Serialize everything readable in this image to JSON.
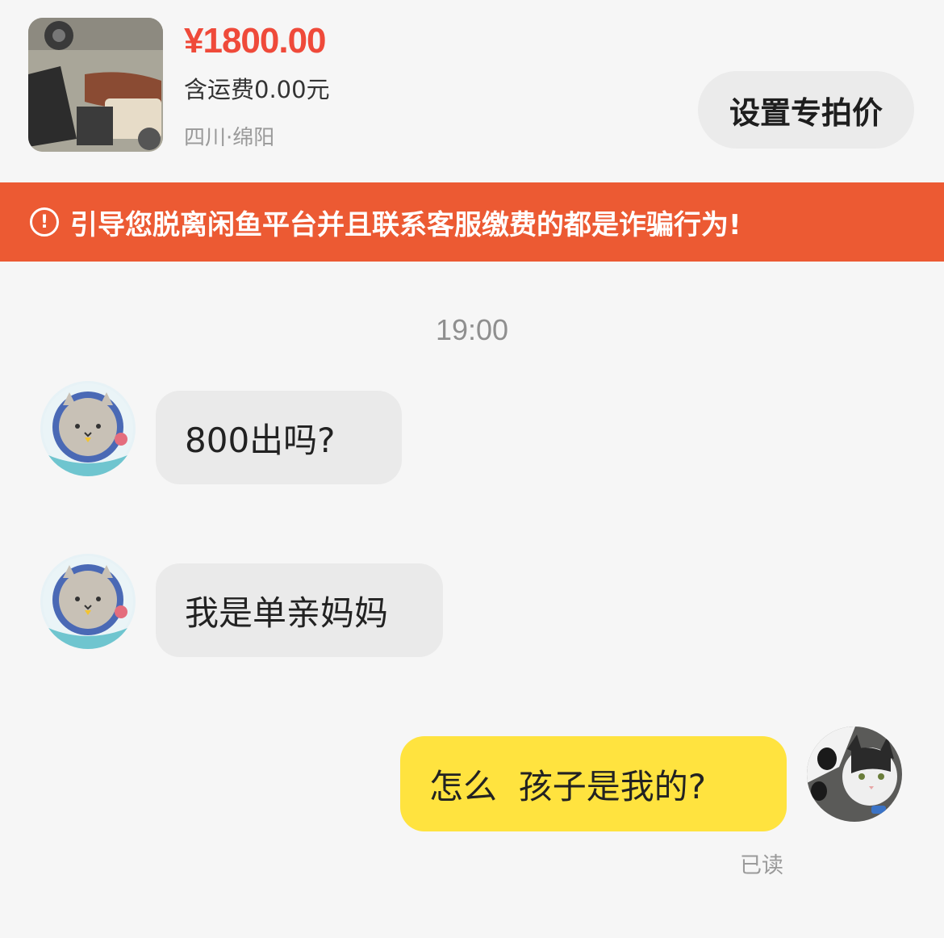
{
  "product": {
    "price": "¥1800.00",
    "shipping": "含运费0.00元",
    "location": "四川·绵阳",
    "set_special_price_label": "设置专拍价"
  },
  "warning": {
    "icon": "exclamation-circle-icon",
    "text": "引导您脱离闲鱼平台并且联系客服缴费的都是诈骗行为!"
  },
  "chat": {
    "timestamp": "19:00",
    "messages": [
      {
        "sender": "other",
        "text": "800出吗?"
      },
      {
        "sender": "other",
        "text": "我是单亲妈妈"
      },
      {
        "sender": "self",
        "text": "怎么  孩子是我的?"
      }
    ],
    "read_status": "已读"
  },
  "colors": {
    "price": "#ef4a3a",
    "warning_banner": "#ec5a33",
    "incoming_bubble": "#eaeaea",
    "outgoing_bubble": "#ffe33f",
    "background": "#f6f6f6"
  }
}
